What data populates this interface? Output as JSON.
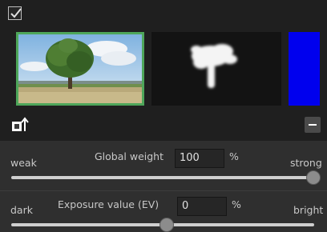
{
  "header": {
    "enabled_checkbox_checked": true
  },
  "thumbnails": [
    {
      "kind": "photo",
      "icon": "tree-landscape-photo",
      "selected": true,
      "border_color": "#4ea65a"
    },
    {
      "kind": "mask",
      "icon": "mask-preview"
    },
    {
      "kind": "color",
      "color": "#0000ee"
    }
  ],
  "toolbar": {
    "left_icon": "add-to-layer-icon",
    "right_icon": "minus-icon"
  },
  "global_weight": {
    "left_label": "weak",
    "title": "Global weight",
    "value": "100",
    "unit": "%",
    "right_label": "strong",
    "slider_value": 1.0
  },
  "exposure": {
    "left_label": "dark",
    "title": "Exposure value (EV)",
    "value": "0",
    "unit": "%",
    "right_label": "bright",
    "slider_value": 0.5
  }
}
